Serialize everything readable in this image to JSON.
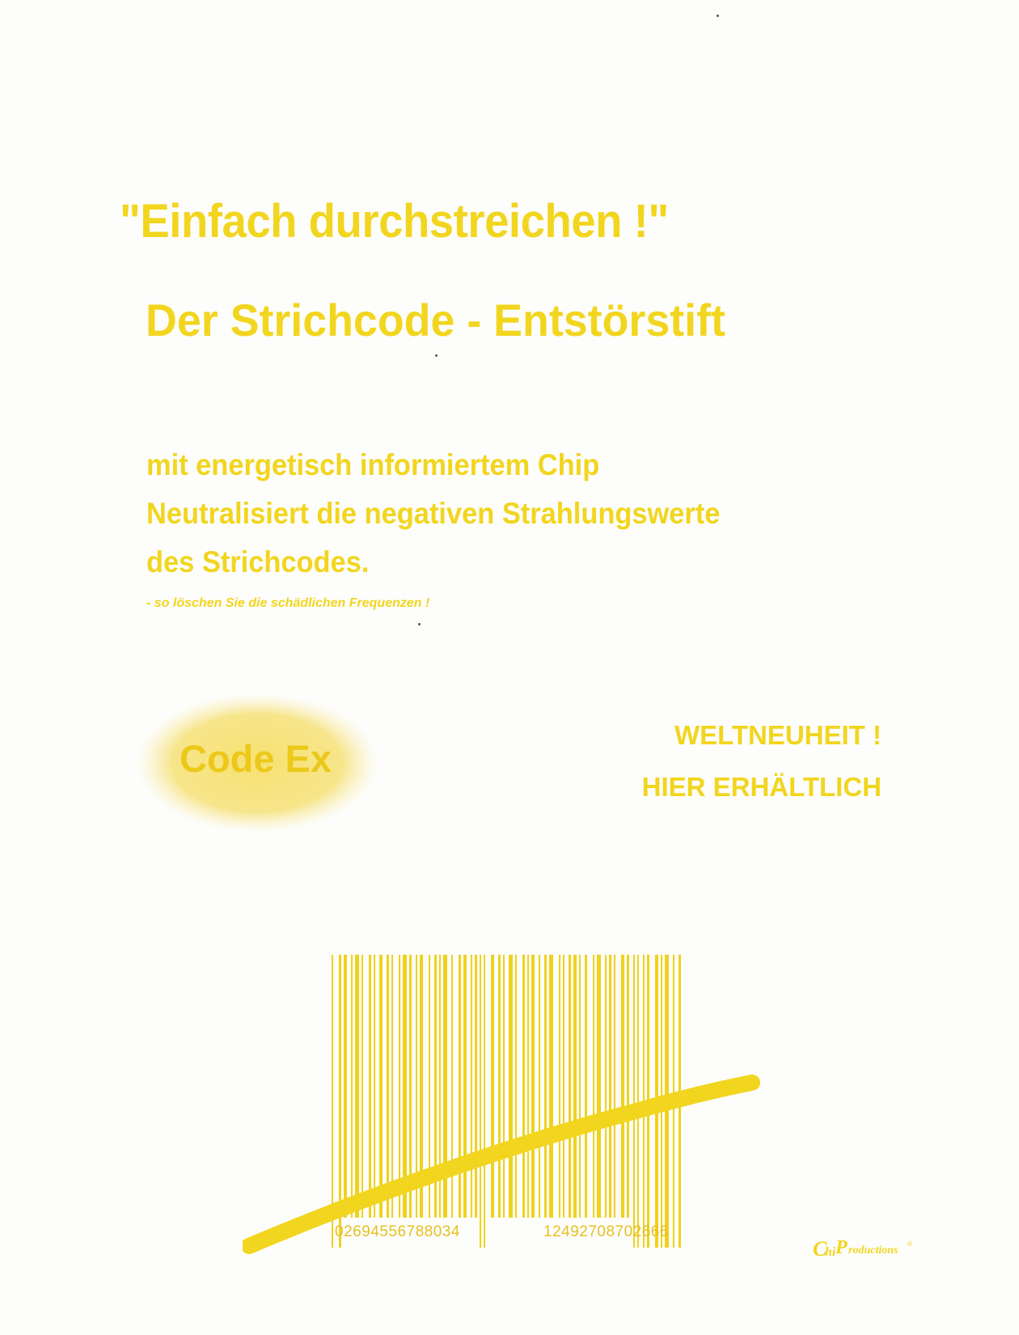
{
  "headline": "\"Einfach durchstreichen !\"",
  "subtitle": "Der Strichcode - Entstörstift",
  "body_lines": [
    "mit energetisch informiertem Chip",
    "Neutralisiert die negativen Strahlungswerte",
    "des Strichcodes."
  ],
  "note": "- so löschen Sie die schädlichen Frequenzen !",
  "product_badge": "Code Ex",
  "promo_line1": "WELTNEUHEIT !",
  "promo_line2": "HIER ERHÄLTLICH",
  "barcode_left_digits": "02694556788034",
  "barcode_right_digits": "12492708702666",
  "logo_text": "ChiProductions®",
  "colors": {
    "ink": "#f2d51e",
    "paper": "#fdfdfb"
  }
}
